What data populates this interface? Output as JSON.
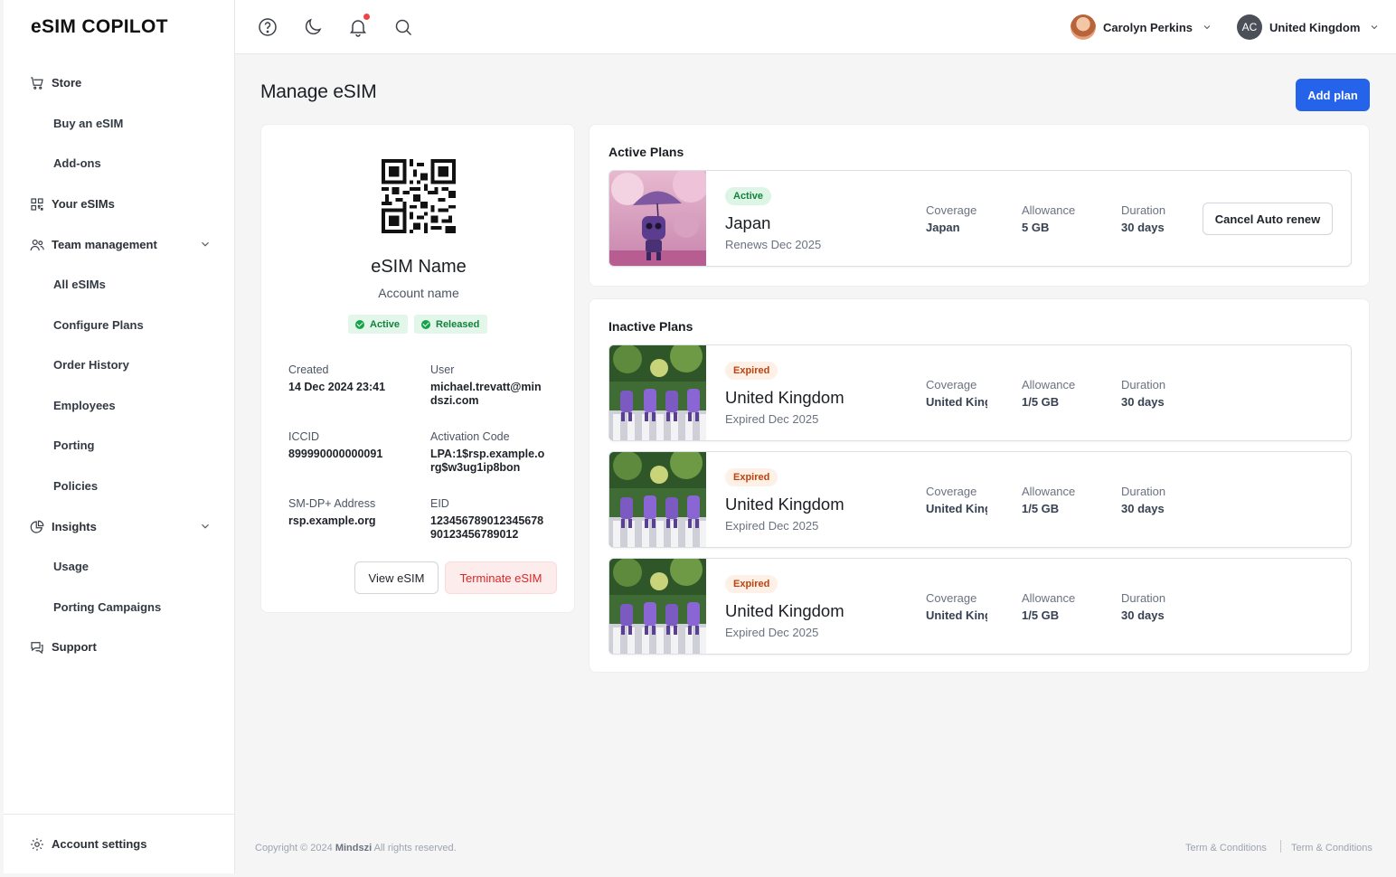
{
  "app": {
    "logo": "eSIM COPILOT"
  },
  "sidebar": {
    "items": [
      {
        "label": "Store",
        "icon": "cart-icon",
        "type": "section"
      },
      {
        "label": "Buy an eSIM",
        "type": "sub"
      },
      {
        "label": "Add-ons",
        "type": "sub"
      },
      {
        "label": "Your eSIMs",
        "icon": "qr-grid-icon",
        "type": "section"
      },
      {
        "label": "Team management",
        "icon": "users-icon",
        "type": "section",
        "expandable": true
      },
      {
        "label": "All eSIMs",
        "type": "sub"
      },
      {
        "label": "Configure Plans",
        "type": "sub"
      },
      {
        "label": "Order History",
        "type": "sub"
      },
      {
        "label": "Employees",
        "type": "sub"
      },
      {
        "label": "Porting",
        "type": "sub"
      },
      {
        "label": "Policies",
        "type": "sub"
      },
      {
        "label": "Insights",
        "icon": "pie-chart-icon",
        "type": "section",
        "expandable": true
      },
      {
        "label": "Usage",
        "type": "sub"
      },
      {
        "label": "Porting Campaigns",
        "type": "sub"
      },
      {
        "label": "Support",
        "icon": "chat-icon",
        "type": "section"
      }
    ],
    "footer": {
      "label": "Account settings",
      "icon": "gear-icon"
    }
  },
  "topbar": {
    "icons": [
      "help-icon",
      "moon-icon",
      "bell-icon",
      "search-icon"
    ],
    "user": {
      "name": "Carolyn Perkins"
    },
    "region": {
      "initials": "AC",
      "name": "United Kingdom"
    }
  },
  "page": {
    "title": "Manage eSIM",
    "add_plan_label": "Add plan"
  },
  "esim": {
    "name": "eSIM Name",
    "account": "Account name",
    "badges": [
      "Active",
      "Released"
    ],
    "fields": {
      "created_label": "Created",
      "created_value": "14 Dec 2024 23:41",
      "user_label": "User",
      "user_value": "michael.trevatt@mindszi.com",
      "iccid_label": "ICCID",
      "iccid_value": "899990000000091",
      "activation_label": "Activation Code",
      "activation_value": "LPA:1$rsp.example.org$w3ug1ip8bon",
      "smdp_label": "SM-DP+ Address",
      "smdp_value": "rsp.example.org",
      "eid_label": "EID",
      "eid_value": "12345678901234567890123456789012"
    },
    "view_label": "View eSIM",
    "terminate_label": "Terminate eSIM"
  },
  "active_plans": {
    "title": "Active Plans",
    "plans": [
      {
        "status": "Active",
        "name": "Japan",
        "sub": "Renews Dec 2025",
        "coverage_label": "Coverage",
        "coverage": "Japan",
        "allowance_label": "Allowance",
        "allowance": "5 GB",
        "duration_label": "Duration",
        "duration": "30 days",
        "action_label": "Cancel Auto renew"
      }
    ]
  },
  "inactive_plans": {
    "title": "Inactive Plans",
    "plans": [
      {
        "status": "Expired",
        "name": "United Kingdom",
        "sub": "Expired Dec 2025",
        "coverage_label": "Coverage",
        "coverage": "United Kingdom",
        "allowance_label": "Allowance",
        "allowance": "1/5 GB",
        "duration_label": "Duration",
        "duration": "30 days"
      },
      {
        "status": "Expired",
        "name": "United Kingdom",
        "sub": "Expired Dec 2025",
        "coverage_label": "Coverage",
        "coverage": "United Kingdom",
        "allowance_label": "Allowance",
        "allowance": "1/5 GB",
        "duration_label": "Duration",
        "duration": "30 days"
      },
      {
        "status": "Expired",
        "name": "United Kingdom",
        "sub": "Expired Dec 2025",
        "coverage_label": "Coverage",
        "coverage": "United Kingdom",
        "allowance_label": "Allowance",
        "allowance": "1/5 GB",
        "duration_label": "Duration",
        "duration": "30 days"
      }
    ]
  },
  "footer": {
    "copyright_prefix": "Copyright © 2024",
    "company": "Mindszi",
    "copyright_suffix": "All rights reserved.",
    "links": [
      "Term & Conditions",
      "Term & Conditions"
    ]
  },
  "colors": {
    "primary": "#2563eb",
    "danger": "#dc2626",
    "success": "#15803d",
    "warning": "#c2410c"
  }
}
